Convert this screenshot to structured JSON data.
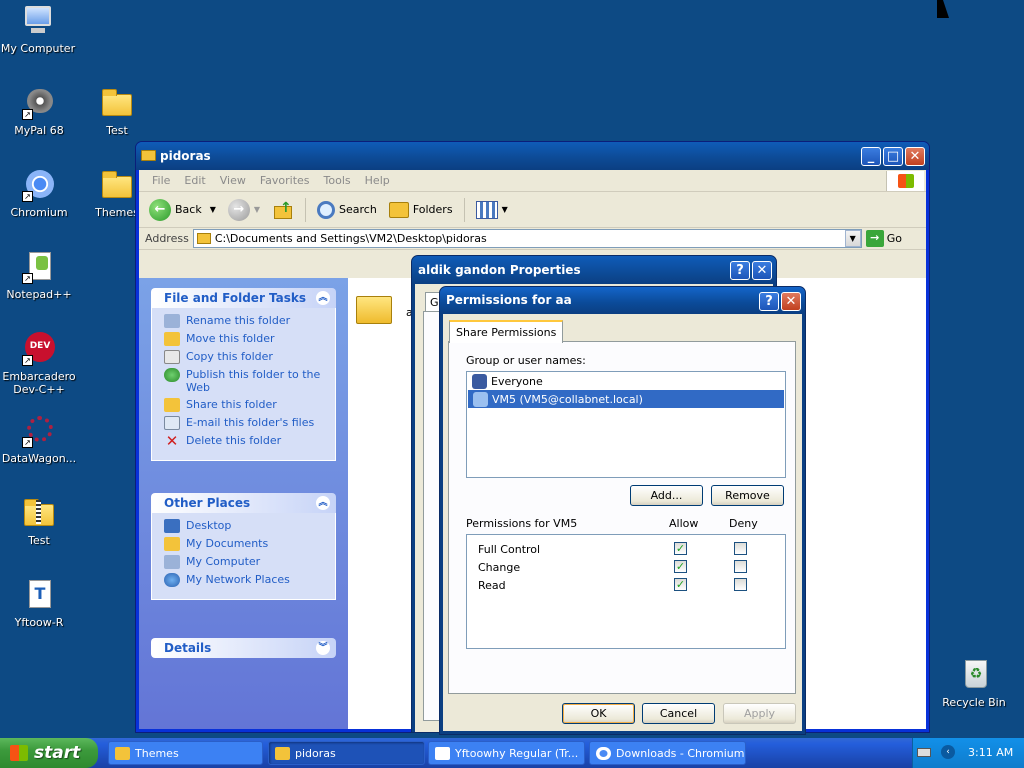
{
  "desktop": {
    "icons": [
      {
        "label": "My Computer"
      },
      {
        "label": "MyPal 68"
      },
      {
        "label": "Test"
      },
      {
        "label": "Chromium"
      },
      {
        "label": "Themes"
      },
      {
        "label": "Notepad++"
      },
      {
        "label": "Embarcadero Dev-C++"
      },
      {
        "label": "DataWagon..."
      },
      {
        "label": "Test"
      },
      {
        "label": "Yftoow-R"
      },
      {
        "label": "Recycle Bin"
      }
    ]
  },
  "explorer": {
    "title": "pidoras",
    "menu": [
      "File",
      "Edit",
      "View",
      "Favorites",
      "Tools",
      "Help"
    ],
    "toolbar": {
      "back": "Back",
      "search": "Search",
      "folders": "Folders"
    },
    "address": {
      "label": "Address",
      "value": "C:\\Documents and Settings\\VM2\\Desktop\\pidoras",
      "go": "Go"
    },
    "file_tasks": {
      "title": "File and Folder Tasks",
      "items": [
        "Rename this folder",
        "Move this folder",
        "Copy this folder",
        "Publish this folder to the Web",
        "Share this folder",
        "E-mail this folder's files",
        "Delete this folder"
      ]
    },
    "other_places": {
      "title": "Other Places",
      "items": [
        "Desktop",
        "My Documents",
        "My Computer",
        "My Network Places"
      ]
    },
    "details": {
      "title": "Details"
    },
    "folder_item_label": "a"
  },
  "properties_dialog": {
    "title": "aldik gandon Properties",
    "tab": "Ge"
  },
  "permissions_dialog": {
    "title": "Permissions for aa",
    "tab": "Share Permissions",
    "group_label": "Group or user names:",
    "users": [
      "Everyone",
      "VM5 (VM5@collabnet.local)"
    ],
    "add_button": "Add...",
    "remove_button": "Remove",
    "perm_label": "Permissions for VM5",
    "allow_header": "Allow",
    "deny_header": "Deny",
    "permissions": [
      {
        "name": "Full Control",
        "allow": true,
        "deny": false
      },
      {
        "name": "Change",
        "allow": true,
        "deny": false
      },
      {
        "name": "Read",
        "allow": true,
        "deny": false
      }
    ],
    "ok": "OK",
    "cancel": "Cancel",
    "apply": "Apply"
  },
  "taskbar": {
    "start": "start",
    "items": [
      "Themes",
      "pidoras",
      "Yftoowhy Regular (Tr...",
      "Downloads - Chromium"
    ],
    "clock": "3:11 AM"
  }
}
